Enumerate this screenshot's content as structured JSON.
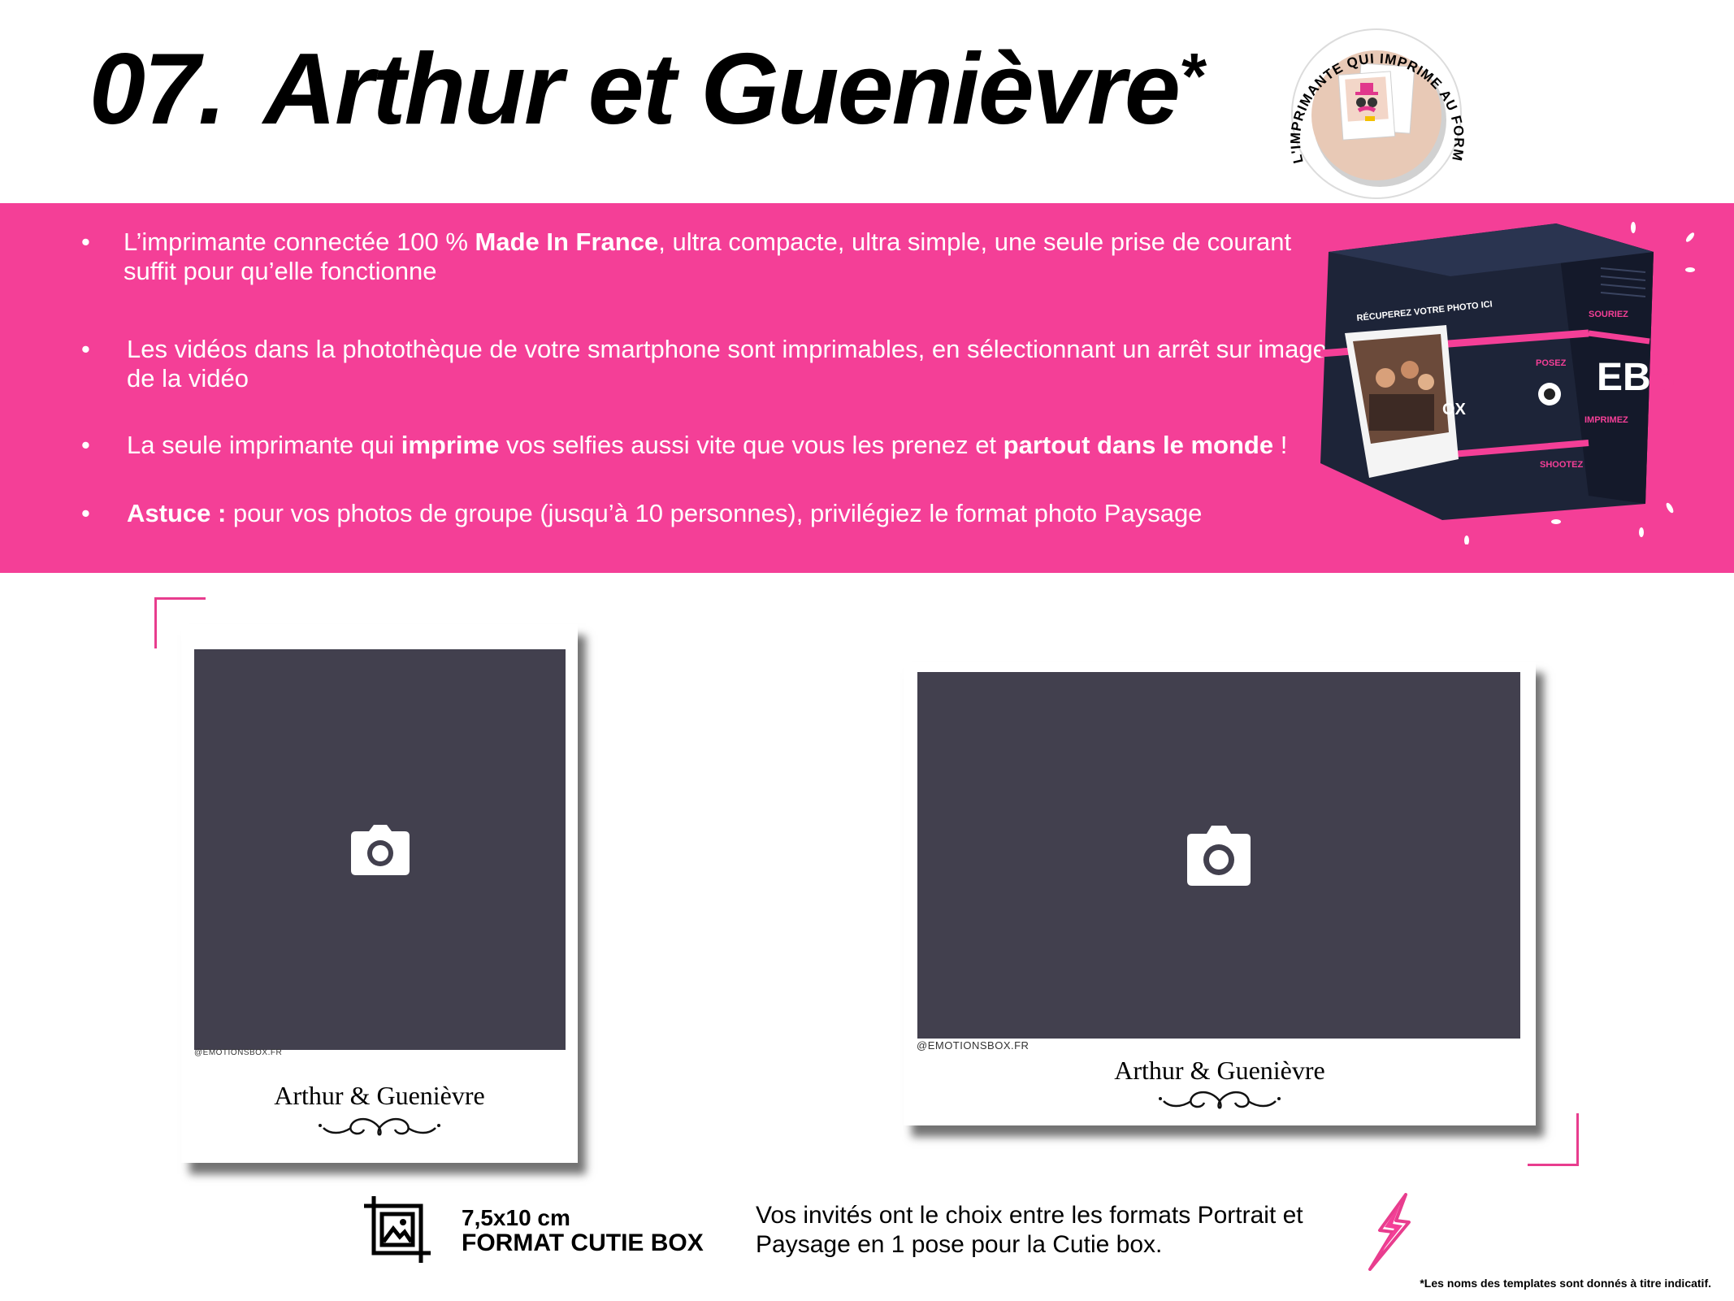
{
  "header": {
    "number": "07.",
    "title": "Arthur et Guenièvre",
    "asterisk": "*"
  },
  "badge": {
    "ring_text": "L'IMPRIMANTE QUI IMPRIME AU FORMAT POLAROÏD"
  },
  "bullets": [
    {
      "dot": "•",
      "parts": [
        {
          "t": "L’imprimante connectée 100 % ",
          "b": false
        },
        {
          "t": "Made In France",
          "b": true
        },
        {
          "t": ", ultra compacte, ultra simple, une seule prise de courant suffit pour qu’elle fonctionne",
          "b": false
        }
      ]
    },
    {
      "dot": "•",
      "parts": [
        {
          "t": "Les vidéos dans la photothèque de votre smartphone sont imprimables, en sélectionnant un arrêt sur image de la vidéo",
          "b": false
        }
      ]
    },
    {
      "dot": "•",
      "parts": [
        {
          "t": "La seule imprimante qui ",
          "b": false
        },
        {
          "t": "imprime",
          "b": true
        },
        {
          "t": " vos selfies aussi vite que vous les prenez et ",
          "b": false
        },
        {
          "t": "partout dans le monde",
          "b": true
        },
        {
          "t": " !",
          "b": false
        }
      ]
    },
    {
      "dot": "•",
      "parts": [
        {
          "t": "Astuce :",
          "b": true
        },
        {
          "t": " pour vos photos de groupe (jusqu’à 10 personnes), privilégiez le format photo Paysage",
          "b": false
        }
      ]
    }
  ],
  "printer": {
    "screen_text": "RÉCUPEREZ VOTRE PHOTO ICI",
    "logo": "EB",
    "side_words": [
      "POSEZ",
      "SOURIEZ",
      "IMPRIMEZ",
      "SHOOTEZ"
    ],
    "brand_fragment": "OX"
  },
  "templates": {
    "portrait": {
      "handle": "@EMOTIONSBOX.FR",
      "names": "Arthur & Guenièvre",
      "icon": "camera-icon"
    },
    "landscape": {
      "handle": "@EMOTIONSBOX.FR",
      "names": "Arthur & Guenièvre",
      "icon": "camera-icon"
    }
  },
  "format": {
    "size": "7,5x10 cm",
    "name": "FORMAT CUTIE BOX",
    "icon": "crop-icon"
  },
  "choice_text": "Vos invités ont le choix entre les formats Portrait et Paysage en 1 pose pour la Cutie box.",
  "footnote": "*Les noms des templates sont donnés à titre indicatif.",
  "colors": {
    "accent_pink": "#f43f97",
    "photo_placeholder": "#42404e",
    "badge_fill": "#e8c9b6"
  }
}
